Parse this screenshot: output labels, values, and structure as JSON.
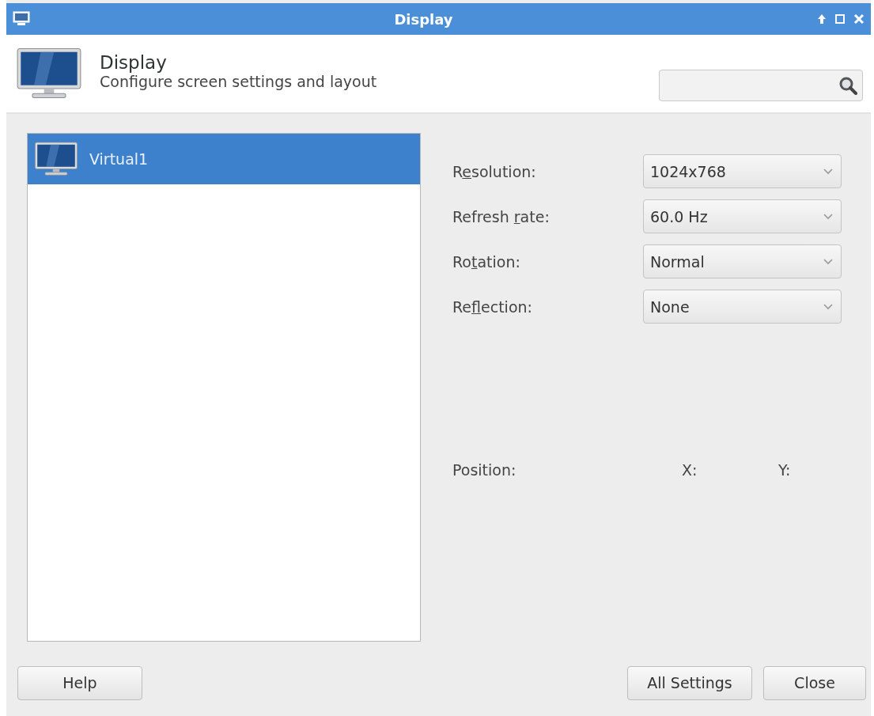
{
  "window": {
    "title": "Display"
  },
  "header": {
    "title": "Display",
    "subtitle": "Configure screen settings and layout"
  },
  "monitors": [
    {
      "name": "Virtual1",
      "selected": true
    }
  ],
  "settings": [
    {
      "label": [
        "R",
        "e",
        "solution:"
      ],
      "value": "1024x768"
    },
    {
      "label": [
        "Refresh ",
        "r",
        "ate:"
      ],
      "value": "60.0 Hz"
    },
    {
      "label": [
        "Ro",
        "t",
        "ation:"
      ],
      "value": "Normal"
    },
    {
      "label": [
        "Re",
        "f",
        "lection:"
      ],
      "value": "None"
    }
  ],
  "position": {
    "label": "Position:",
    "x_label": "X:",
    "y_label": "Y:"
  },
  "buttons": {
    "left": [
      "Help"
    ],
    "right": [
      "All Settings",
      "Close"
    ]
  }
}
